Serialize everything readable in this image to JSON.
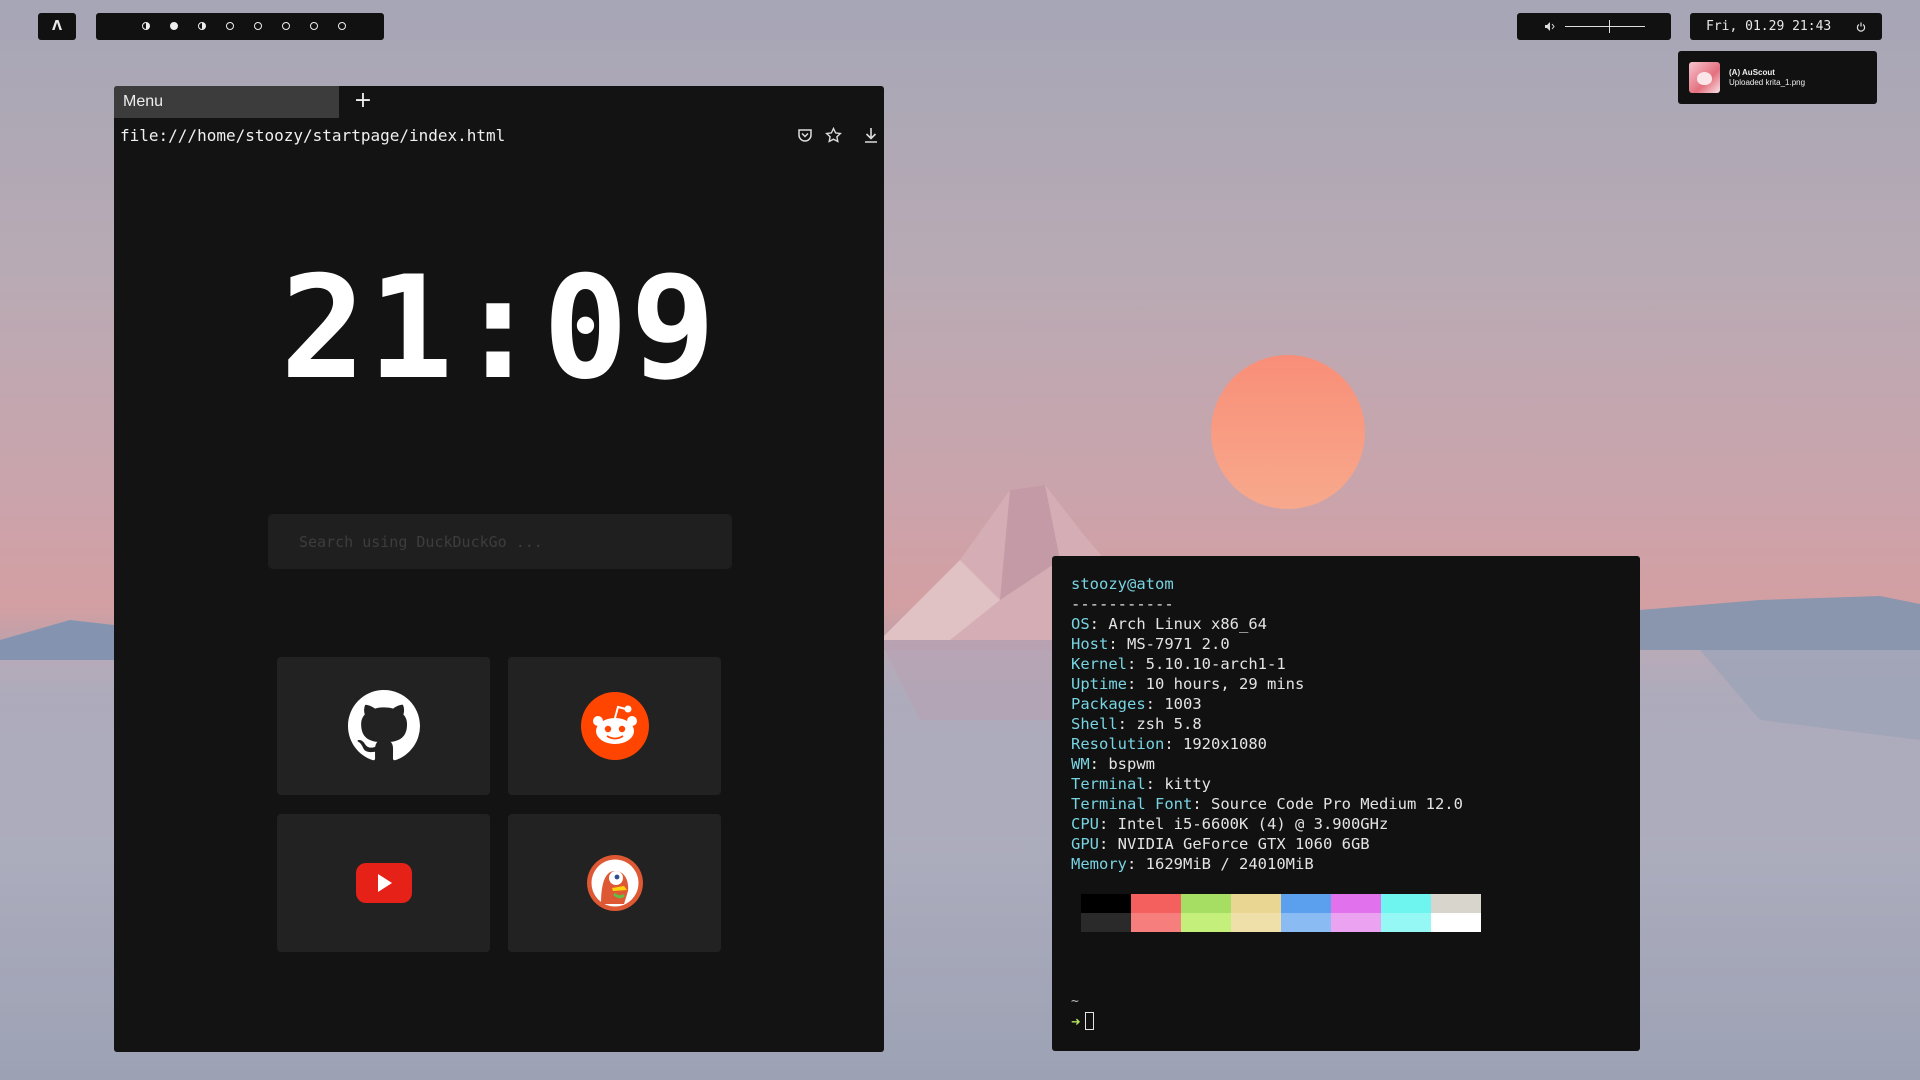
{
  "topbar": {
    "logo": "Λ",
    "workspaces": [
      "half",
      "full",
      "half",
      "empty",
      "empty",
      "empty",
      "empty",
      "empty"
    ],
    "volume_icon": "speaker-icon",
    "volume_level": 0.55,
    "datetime": "Fri, 01.29 21:43",
    "power_icon": "power-icon"
  },
  "notification": {
    "title": "(A) AuScout",
    "body": "Uploaded krita_1.png"
  },
  "browser": {
    "tab_label": "Menu",
    "new_tab": "+",
    "url": "file:///home/stoozy/startpage/index.html",
    "clock": "21:09",
    "search_placeholder": "Search using DuckDuckGo ...",
    "shortcuts": [
      "github-icon",
      "reddit-icon",
      "youtube-icon",
      "duckduckgo-icon"
    ]
  },
  "terminal": {
    "user_host": "stoozy@atom",
    "separator": "-----------",
    "info": [
      {
        "key": "OS",
        "value": " Arch Linux x86_64"
      },
      {
        "key": "Host",
        "value": " MS-7971 2.0"
      },
      {
        "key": "Kernel",
        "value": " 5.10.10-arch1-1"
      },
      {
        "key": "Uptime",
        "value": " 10 hours, 29 mins"
      },
      {
        "key": "Packages",
        "value": " 1003"
      },
      {
        "key": "Shell",
        "value": " zsh 5.8"
      },
      {
        "key": "Resolution",
        "value": " 1920x1080"
      },
      {
        "key": "WM",
        "value": " bspwm"
      },
      {
        "key": "Terminal",
        "value": " kitty"
      },
      {
        "key": "Terminal Font",
        "value": " Source Code Pro Medium 12.0"
      },
      {
        "key": "CPU",
        "value": " Intel i5-6600K (4) @ 3.900GHz"
      },
      {
        "key": "GPU",
        "value": " NVIDIA GeForce GTX 1060 6GB"
      },
      {
        "key": "Memory",
        "value": " 1629MiB / 24010MiB"
      }
    ],
    "palette_top": [
      "#000000",
      "#f4605d",
      "#a6de64",
      "#e8d692",
      "#5ba0ef",
      "#e171ec",
      "#6ff5ef",
      "#d8d5cc"
    ],
    "palette_bottom": [
      "#2a2a2a",
      "#f67e7c",
      "#c4ef7a",
      "#efe0a9",
      "#8abcf3",
      "#eba2f1",
      "#96f8f4",
      "#ffffff"
    ],
    "prompt_dir": "~",
    "prompt_arrow": "➜"
  }
}
